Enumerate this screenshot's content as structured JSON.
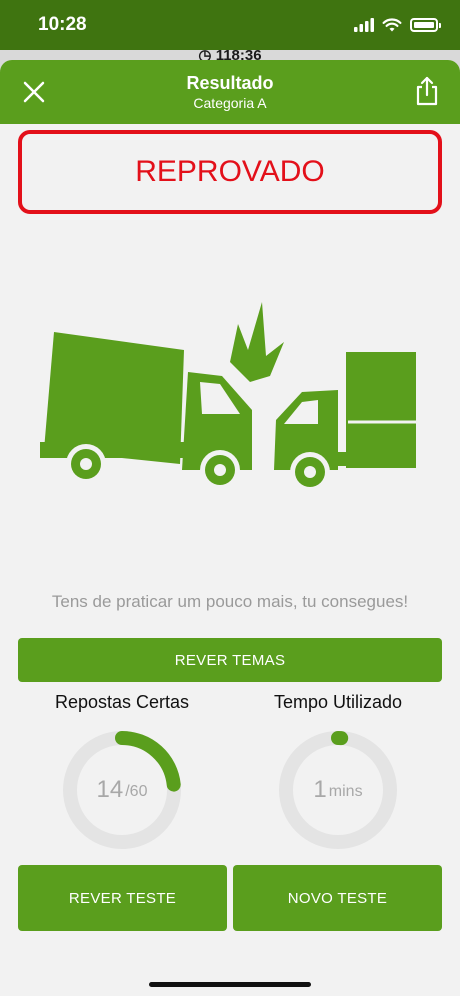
{
  "status_bar": {
    "time": "10:28"
  },
  "background": {
    "timer_text": "118:36"
  },
  "header": {
    "title": "Resultado",
    "subtitle": "Categoria A"
  },
  "result": {
    "label": "REPROVADO",
    "color": "#e3101a"
  },
  "message": "Tens de praticar um pouco mais, tu consegues!",
  "buttons": {
    "review_topics": "REVER TEMAS",
    "review_test": "REVER TESTE",
    "new_test": "NOVO TESTE"
  },
  "stats": {
    "correct": {
      "label": "Repostas Certas",
      "value": "14",
      "total": "/60",
      "fraction": 0.233
    },
    "time": {
      "label": "Tempo Utilizado",
      "value": "1",
      "unit": "mins",
      "fraction": 0.01
    }
  },
  "colors": {
    "accent": "#5a9e1d",
    "ring_track": "#e4e4e4"
  }
}
